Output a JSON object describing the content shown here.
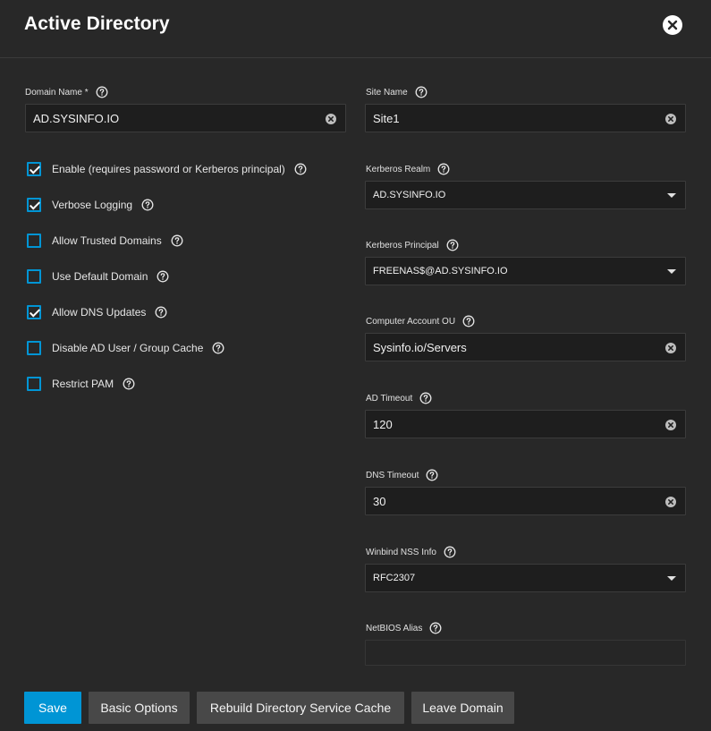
{
  "dialog": {
    "title": "Active Directory"
  },
  "left_fields": {
    "domain_name": {
      "label": "Domain Name *",
      "value": "AD.SYSINFO.IO"
    }
  },
  "checkboxes": [
    {
      "label": "Enable (requires password or Kerberos principal)",
      "checked": true
    },
    {
      "label": "Verbose Logging",
      "checked": true
    },
    {
      "label": "Allow Trusted Domains",
      "checked": false
    },
    {
      "label": "Use Default Domain",
      "checked": false
    },
    {
      "label": "Allow DNS Updates",
      "checked": true
    },
    {
      "label": "Disable AD User / Group Cache",
      "checked": false
    },
    {
      "label": "Restrict PAM",
      "checked": false
    }
  ],
  "right_fields": {
    "site_name": {
      "label": "Site Name",
      "value": "Site1"
    },
    "kerberos_realm": {
      "label": "Kerberos Realm",
      "value": "AD.SYSINFO.IO"
    },
    "kerberos_principal": {
      "label": "Kerberos Principal",
      "value": "FREENAS$@AD.SYSINFO.IO"
    },
    "computer_account_ou": {
      "label": "Computer Account OU",
      "value": "Sysinfo.io/Servers"
    },
    "ad_timeout": {
      "label": "AD Timeout",
      "value": "120"
    },
    "dns_timeout": {
      "label": "DNS Timeout",
      "value": "30"
    },
    "winbind_nss_info": {
      "label": "Winbind NSS Info",
      "value": "RFC2307"
    },
    "netbios_alias": {
      "label": "NetBIOS Alias",
      "value": ""
    }
  },
  "buttons": {
    "save": "Save",
    "basic_options": "Basic Options",
    "rebuild_cache": "Rebuild Directory Service Cache",
    "leave_domain": "Leave Domain"
  },
  "colors": {
    "accent": "#0095d5",
    "background": "#282828",
    "field_background": "#1e1e1e"
  },
  "icons": {
    "close": "close-icon",
    "help": "help-circle-icon",
    "clear": "clear-circle-icon",
    "dropdown": "chevron-down-icon"
  }
}
